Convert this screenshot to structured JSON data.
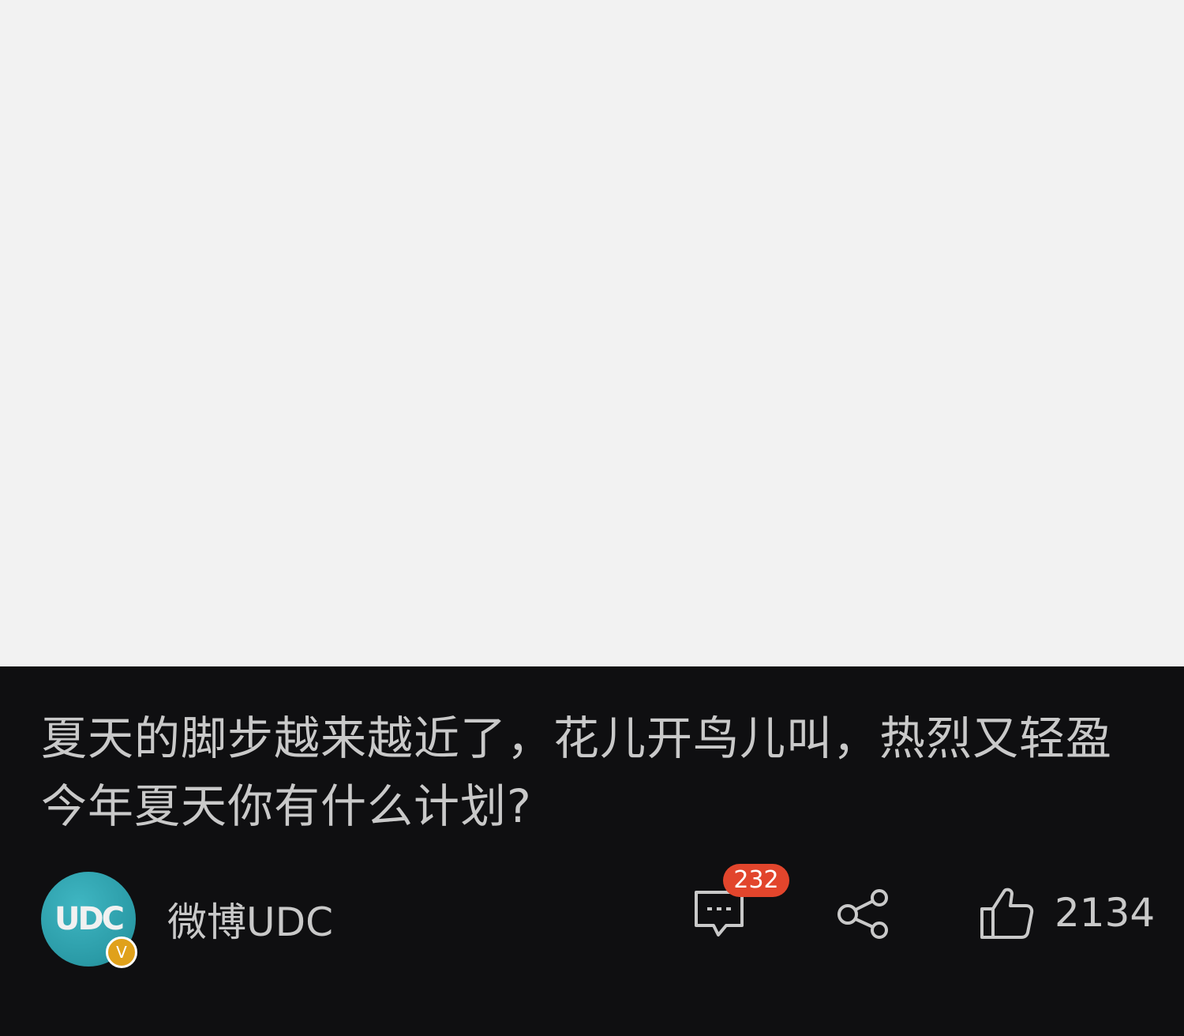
{
  "post": {
    "caption_line1": "夏天的脚步越来越近了，花儿开鸟儿叫，热烈又轻盈",
    "caption_line2": "今年夏天你有什么计划?"
  },
  "author": {
    "name": "微博UDC",
    "avatar_text": "UDC",
    "verified_mark": "V"
  },
  "actions": {
    "comment_count": "232",
    "like_count": "2134"
  },
  "icons": {
    "comment": "comment-icon",
    "share": "share-icon",
    "like": "thumbs-up-icon"
  },
  "colors": {
    "panel_background": "#0f0f11",
    "media_background": "#f2f2f2",
    "text": "#c9c9c9",
    "badge_red": "#e2452c",
    "verified_gold": "#e0a11b",
    "avatar_teal": "#2a9aa6"
  }
}
